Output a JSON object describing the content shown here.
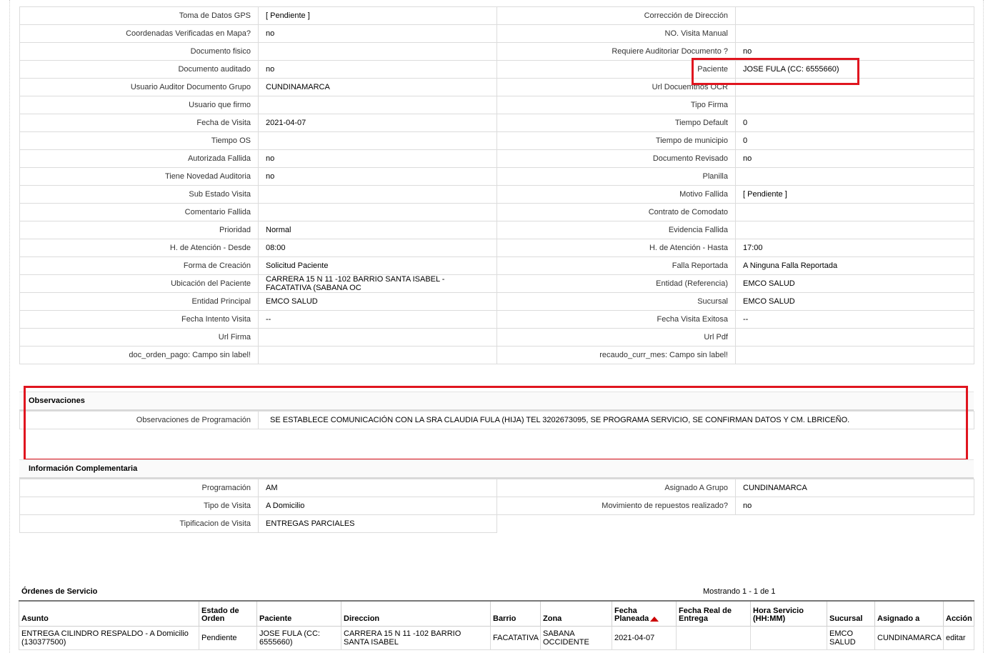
{
  "details": {
    "rows": [
      [
        "Toma de Datos GPS",
        "[ Pendiente ]",
        "Corrección de Dirección",
        ""
      ],
      [
        "Coordenadas Verificadas en Mapa?",
        " no",
        "NO. Visita Manual",
        ""
      ],
      [
        "Documento fisico",
        "",
        "Requiere Auditoriar Documento ?",
        " no"
      ],
      [
        "Documento auditado",
        " no",
        "Paciente",
        "JOSE FULA (CC: 6555660)"
      ],
      [
        "Usuario Auditor Documento Grupo",
        "CUNDINAMARCA",
        "Url Docuemtnos OCR",
        ""
      ],
      [
        "Usuario que firmo",
        "",
        "Tipo Firma",
        ""
      ],
      [
        "Fecha de Visita",
        " 2021-04-07",
        "Tiempo Default",
        "0"
      ],
      [
        "Tiempo OS",
        "",
        "Tiempo de municipio",
        "0"
      ],
      [
        "Autorizada Fallida",
        " no",
        "Documento Revisado",
        " no"
      ],
      [
        "Tiene Novedad Auditoria",
        " no",
        "Planilla",
        ""
      ],
      [
        "Sub Estado Visita",
        "",
        "Motivo Fallida",
        "[ Pendiente ]"
      ],
      [
        "Comentario Fallida",
        "",
        "Contrato de Comodato",
        ""
      ],
      [
        "Prioridad",
        "Normal",
        "Evidencia Fallida",
        ""
      ],
      [
        "H. de Atención - Desde",
        "08:00",
        "H. de Atención - Hasta",
        "17:00"
      ],
      [
        "Forma de Creación",
        "Solicitud Paciente",
        "Falla Reportada",
        "A Ninguna Falla Reportada"
      ],
      [
        "Ubicación del Paciente",
        "CARRERA 15 N 11 -102 BARRIO SANTA ISABEL - FACATATIVA (SABANA OC",
        "Entidad (Referencia)",
        "EMCO SALUD"
      ],
      [
        "Entidad Principal",
        "EMCO SALUD",
        "Sucursal",
        "EMCO SALUD"
      ],
      [
        "Fecha Intento Visita",
        " --",
        "Fecha Visita Exitosa",
        " --"
      ],
      [
        "Url Firma",
        "",
        "Url Pdf",
        ""
      ],
      [
        "doc_orden_pago: Campo sin label!",
        "",
        "recaudo_curr_mes: Campo sin label!",
        ""
      ]
    ]
  },
  "observaciones": {
    "title": "Observaciones",
    "label": "Observaciones de Programación",
    "value": "SE ESTABLECE COMUNICACIÓN CON LA SRA CLAUDIA FULA (HIJA) TEL 3202673095, SE PROGRAMA SERVICIO, SE CONFIRMAN DATOS Y CM. LBRICEÑO."
  },
  "complementaria": {
    "title": "Información Complementaria",
    "rows": [
      [
        "Programación",
        "AM",
        "Asignado A Grupo",
        "CUNDINAMARCA"
      ],
      [
        "Tipo de Visita",
        "A Domicilio",
        "Movimiento de repuestos realizado?",
        " no"
      ],
      [
        "Tipificacion de Visita",
        "ENTREGAS PARCIALES",
        "",
        ""
      ]
    ]
  },
  "orders": {
    "title": "Órdenes de Servicio",
    "showing": "Mostrando 1 - 1 de 1",
    "headers": [
      "Asunto",
      "Estado de Orden",
      "Paciente",
      "Direccion",
      "Barrio",
      "Zona",
      "Fecha Planeada",
      "Fecha Real de Entrega",
      "Hora Servicio (HH:MM)",
      "Sucursal",
      "Asignado a",
      "Acción"
    ],
    "rows": [
      [
        "ENTREGA CILINDRO RESPALDO - A Domicilio (130377500)",
        "Pendiente",
        "JOSE FULA (CC: 6555660)",
        "CARRERA 15 N 11 -102 BARRIO SANTA ISABEL",
        "FACATATIVA",
        "SABANA OCCIDENTE",
        "2021-04-07",
        "",
        "",
        "EMCO SALUD",
        "CUNDINAMARCA",
        "editar"
      ]
    ]
  },
  "colors": {
    "highlight": "#e0151f",
    "sort_arrow": "#cc0000"
  }
}
